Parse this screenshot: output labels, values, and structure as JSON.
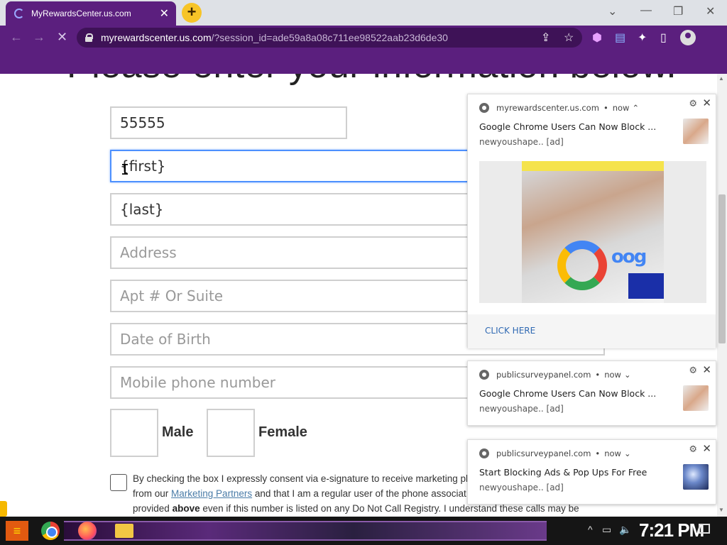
{
  "browser": {
    "tab_title": "MyRewardsCenter.us.com",
    "tab_close": "✕",
    "new_tab": "+",
    "url_domain": "myrewardscenter.us.com",
    "url_path": "/?session_id=ade59a8a08c711ee98522aab23d6de30",
    "window_controls": {
      "tab_search": "⌄",
      "minimize": "—",
      "restore": "❐",
      "close": "✕"
    },
    "nav": {
      "back": "←",
      "forward": "→",
      "stop": "✕"
    },
    "toolbar_icons": {
      "share": "⇪",
      "star": "☆",
      "ext1": "⬢",
      "ext2": "▤",
      "extensions": "✦",
      "sidepanel": "▯"
    }
  },
  "page": {
    "heading": "Please enter your information below.",
    "fields": {
      "zip": "55555",
      "first": "{first}",
      "last": "{last}",
      "address_ph": "Address",
      "apt_ph": "Apt # Or Suite",
      "dob_ph": "Date of Birth",
      "phone_ph": "Mobile phone number"
    },
    "gender": {
      "male": "Male",
      "female": "Female"
    },
    "consent": {
      "text1": "By checking the box I expressly consent via e-signature to receive marketing ph",
      "text2": "from our",
      "link": "Marketing Partners",
      "text3": "and that I am a regular user of the phone associat",
      "text4": "provided",
      "bold": "above",
      "text5": "even if this number is listed on any Do Not Call Registry. I understand these calls may be"
    }
  },
  "notifications": [
    {
      "site": "myrewardscenter.us.com",
      "time": "now",
      "chevron": "⌃",
      "title": "Google Chrome Users Can Now Block ...",
      "sub": "newyoushape.. [ad]",
      "action": "CLICK HERE"
    },
    {
      "site": "publicsurveypanel.com",
      "time": "now",
      "chevron": "⌄",
      "title": "Google Chrome Users Can Now Block ...",
      "sub": "newyoushape.. [ad]"
    },
    {
      "site": "publicsurveypanel.com",
      "time": "now",
      "chevron": "⌄",
      "title": "Start Blocking Ads & Pop Ups For Free",
      "sub": "newyoushape.. [ad]"
    }
  ],
  "notif_controls": {
    "gear": "⚙",
    "close": "✕",
    "sep": "•"
  },
  "taskbar": {
    "clock": "7:21 PM",
    "tray": {
      "up": "^",
      "network": "▭",
      "volume": "🔈"
    }
  }
}
